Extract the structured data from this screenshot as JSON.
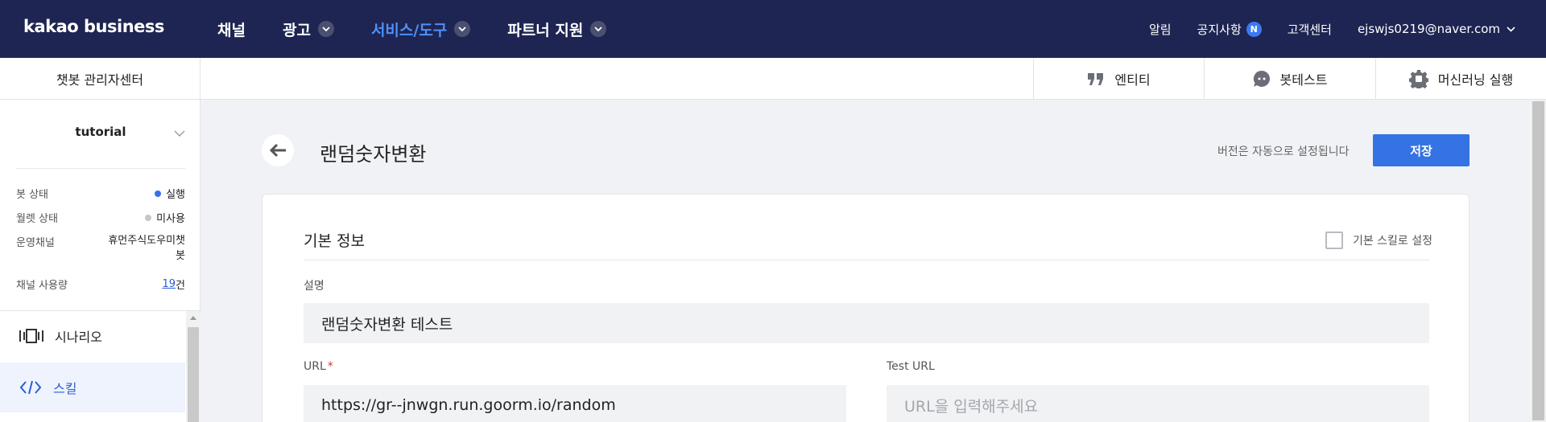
{
  "brand": {
    "logo_text": "kakao business"
  },
  "nav": {
    "items": [
      {
        "label": "채널",
        "has_dropdown": false,
        "active": false
      },
      {
        "label": "광고",
        "has_dropdown": true,
        "active": false
      },
      {
        "label": "서비스/도구",
        "has_dropdown": true,
        "active": true
      },
      {
        "label": "파트너 지원",
        "has_dropdown": true,
        "active": false
      }
    ],
    "right": {
      "alerts": "알림",
      "notices": "공지사항",
      "notices_badge": "N",
      "support": "고객센터",
      "account": "ejswjs0219@naver.com"
    }
  },
  "subbar": {
    "title": "챗봇 관리자센터",
    "tools": [
      {
        "label": "엔티티",
        "icon": "quote-icon"
      },
      {
        "label": "봇테스트",
        "icon": "chat-bubble-icon"
      },
      {
        "label": "머신러닝 실행",
        "icon": "gear-icon"
      }
    ]
  },
  "sidebar": {
    "bot_name": "tutorial",
    "info": [
      {
        "key": "봇 상태",
        "value": "실행",
        "dot_color": "#3572e3"
      },
      {
        "key": "월렛 상태",
        "value": "미사용",
        "dot_color": "#c4c6cc"
      },
      {
        "key": "운영채널",
        "value_line1": "휴먼주식도우미챗",
        "value_line2": "봇"
      },
      {
        "key": "채널 사용량",
        "count": "19",
        "unit": "건"
      }
    ],
    "menu": [
      {
        "label": "시나리오",
        "icon": "scenario-icon",
        "active": false
      },
      {
        "label": "스킬",
        "icon": "code-icon",
        "active": true
      }
    ]
  },
  "page": {
    "title": "랜덤숫자변환",
    "version_note": "버전은 자동으로 설정됩니다",
    "save_label": "저장"
  },
  "form": {
    "section_title": "기본 정보",
    "default_skill_label": "기본 스킬로 설정",
    "default_skill_checked": false,
    "description_label": "설명",
    "description_value": "랜덤숫자변환 테스트",
    "url_label": "URL",
    "url_required_mark": "*",
    "url_value": "https://gr--jnwgn.run.goorm.io/random",
    "test_url_label": "Test URL",
    "test_url_placeholder": "URL을 입력해주세요"
  },
  "colors": {
    "topbar_bg": "#1e2552",
    "accent": "#3572e3",
    "active_nav": "#4e8ff9"
  }
}
